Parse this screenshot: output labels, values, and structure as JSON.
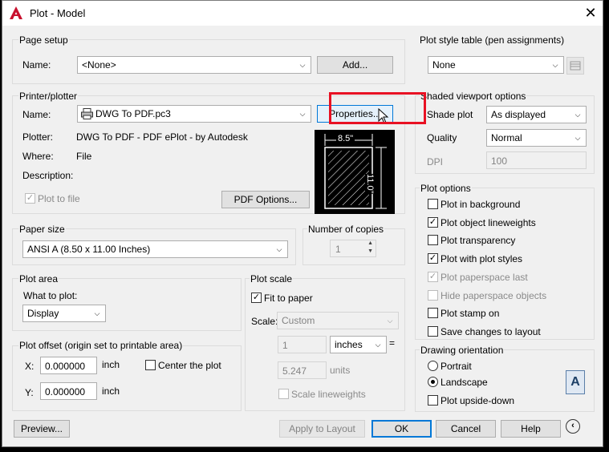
{
  "window": {
    "title": "Plot - Model"
  },
  "page_setup": {
    "group": "Page setup",
    "name_label": "Name:",
    "name_value": "<None>",
    "add_button": "Add..."
  },
  "printer": {
    "group": "Printer/plotter",
    "name_label": "Name:",
    "name_value": "DWG To PDF.pc3",
    "properties_button": "Properties...",
    "plotter_label": "Plotter:",
    "plotter_value": "DWG To PDF - PDF ePlot - by Autodesk",
    "where_label": "Where:",
    "where_value": "File",
    "description_label": "Description:",
    "plot_to_file": "Plot to file",
    "pdf_options_button": "PDF Options...",
    "preview_width": "8.5\"",
    "preview_height": "11.0\""
  },
  "paper_size": {
    "group": "Paper size",
    "value": "ANSI A (8.50 x 11.00 Inches)"
  },
  "copies": {
    "group": "Number of copies",
    "value": "1"
  },
  "plot_area": {
    "group": "Plot area",
    "what_label": "What to plot:",
    "what_value": "Display"
  },
  "plot_offset": {
    "group": "Plot offset (origin set to printable area)",
    "x_label": "X:",
    "x_value": "0.000000",
    "x_unit": "inch",
    "y_label": "Y:",
    "y_value": "0.000000",
    "y_unit": "inch",
    "center_label": "Center the plot"
  },
  "plot_scale": {
    "group": "Plot scale",
    "fit_label": "Fit to paper",
    "scale_label": "Scale:",
    "scale_value": "Custom",
    "num_value": "1",
    "unit_value": "inches",
    "equals": "=",
    "units_value": "5.247",
    "units_label": "units",
    "lineweights_label": "Scale lineweights"
  },
  "style_table": {
    "group": "Plot style table (pen assignments)",
    "value": "None"
  },
  "shaded": {
    "group": "Shaded viewport options",
    "shade_label": "Shade plot",
    "shade_value": "As displayed",
    "quality_label": "Quality",
    "quality_value": "Normal",
    "dpi_label": "DPI",
    "dpi_value": "100"
  },
  "plot_options": {
    "group": "Plot options",
    "items": [
      {
        "label": "Plot in background",
        "checked": false,
        "disabled": false
      },
      {
        "label": "Plot object lineweights",
        "checked": true,
        "disabled": false
      },
      {
        "label": "Plot transparency",
        "checked": false,
        "disabled": false
      },
      {
        "label": "Plot with plot styles",
        "checked": true,
        "disabled": false
      },
      {
        "label": "Plot paperspace last",
        "checked": true,
        "disabled": true
      },
      {
        "label": "Hide paperspace objects",
        "checked": false,
        "disabled": true
      },
      {
        "label": "Plot stamp on",
        "checked": false,
        "disabled": false
      },
      {
        "label": "Save changes to layout",
        "checked": false,
        "disabled": false
      }
    ]
  },
  "orientation": {
    "group": "Drawing orientation",
    "portrait": "Portrait",
    "landscape": "Landscape",
    "upside_down": "Plot upside-down",
    "icon_letter": "A"
  },
  "footer": {
    "preview": "Preview...",
    "apply": "Apply to Layout",
    "ok": "OK",
    "cancel": "Cancel",
    "help": "Help"
  },
  "colors": {
    "highlight": "#e81123",
    "accent": "#0078d7",
    "brand": "#c8102e"
  }
}
